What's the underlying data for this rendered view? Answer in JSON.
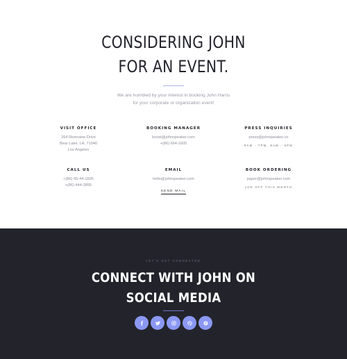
{
  "hero": {
    "title_line1": "CONSIDERING JOHN",
    "title_line2": "FOR AN EVENT.",
    "subtitle_line1": "We are humbled by your interest in booking John Harris",
    "subtitle_line2": "for your corporate or organization event!"
  },
  "contacts": {
    "visit_office": {
      "title": "VISIT OFFICE",
      "lines": [
        "264 Riverview Drive",
        "Bear Lake, LA, 71040",
        "Los Angeles"
      ]
    },
    "booking_manager": {
      "title": "BOOKING MANAGER",
      "lines": [
        "boost@johnspeaker.com",
        "+(86) 664-1605"
      ]
    },
    "press_inquiries": {
      "title": "PRESS INQUIRIES",
      "lines": [
        "press@johnspeaker.co"
      ],
      "note": "9am - 7pm, 8am - 5pm"
    },
    "call_us": {
      "title": "CALL US",
      "lines": [
        "+(86) 66-44-1605",
        "+(86) 444-3895"
      ]
    },
    "email": {
      "title": "EMAIL",
      "lines": [
        "hello@johnspeaker.com"
      ],
      "link": "SEND MAIL"
    },
    "book_ordering": {
      "title": "BOOK ORDERING",
      "lines": [
        "paper@johnspeaker.com"
      ],
      "note": "10% off this month"
    }
  },
  "social": {
    "eyebrow": "LET'S GET CONNECTED",
    "title_line1": "CONNECT WITH JOHN ON",
    "title_line2": "SOCIAL MEDIA",
    "icons": [
      "facebook-icon",
      "twitter-icon",
      "instagram-icon",
      "dribbble-icon",
      "pinterest-icon"
    ]
  },
  "colors": {
    "accent": "#8b98f4",
    "dark_bg": "#23242b",
    "text_dark": "#23242b",
    "text_muted": "#8d8f99"
  }
}
